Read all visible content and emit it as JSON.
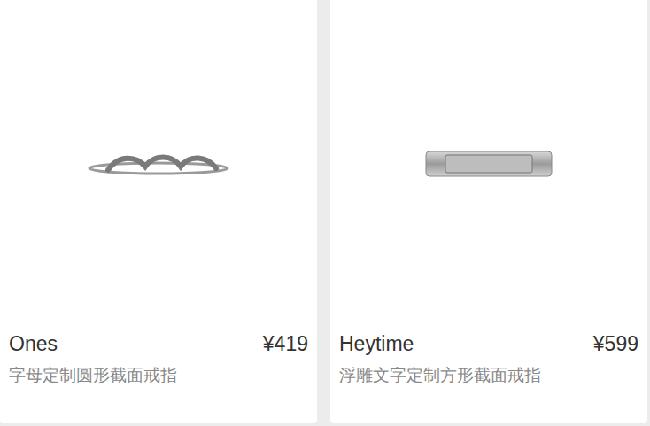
{
  "products": [
    {
      "name": "Ones",
      "price": "¥419",
      "description": "字母定制圆形截面戒指"
    },
    {
      "name": "Heytime",
      "price": "¥599",
      "description": "浮雕文字定制方形截面戒指"
    }
  ]
}
